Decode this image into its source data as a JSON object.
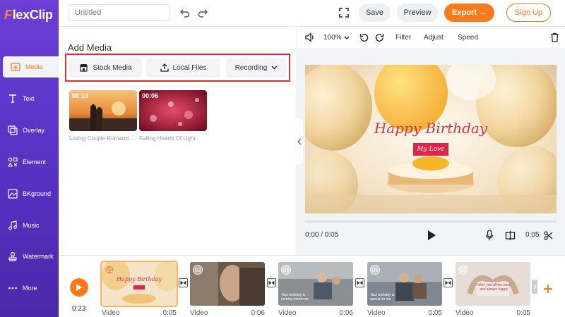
{
  "app": {
    "logo_prefix": "F",
    "logo_rest": "lexClip"
  },
  "sidebar": {
    "items": [
      {
        "label": "Media",
        "icon": "media-icon"
      },
      {
        "label": "Text",
        "icon": "text-icon"
      },
      {
        "label": "Overlay",
        "icon": "overlay-icon"
      },
      {
        "label": "Element",
        "icon": "element-icon"
      },
      {
        "label": "BKground",
        "icon": "background-icon"
      },
      {
        "label": "Music",
        "icon": "music-icon"
      },
      {
        "label": "Watermark",
        "icon": "watermark-icon"
      },
      {
        "label": "More",
        "icon": "more-icon"
      }
    ]
  },
  "topbar": {
    "title_placeholder": "Untitled",
    "save_label": "Save",
    "preview_label": "Preview",
    "export_label": "Export →",
    "signup_label": "Sign Up"
  },
  "media_panel": {
    "title": "Add Media",
    "stock_label": "Stock Media",
    "local_label": "Local Files",
    "recording_label": "Recording",
    "thumbs": [
      {
        "duration": "00:13",
        "caption": "Loving Couple Romanci..."
      },
      {
        "duration": "00:06",
        "caption": "Falling Hearts Of Light"
      }
    ]
  },
  "preview": {
    "zoom": "100%",
    "filter_label": "Filter",
    "adjust_label": "Adjust",
    "speed_label": "Speed",
    "canvas_title": "Happy Birthday",
    "canvas_tag": "My Love",
    "time_current": "0:00 / 0:05",
    "clip_duration": "0:05"
  },
  "timeline": {
    "total_time": "0:23",
    "clips": [
      {
        "num": "01",
        "type": "Video",
        "duration": "0:05",
        "selected": true,
        "text": "Happy Birthday"
      },
      {
        "num": "02",
        "type": "Video",
        "duration": "0:06",
        "selected": false,
        "text": ""
      },
      {
        "num": "03",
        "type": "Video",
        "duration": "0:06",
        "selected": false,
        "text": "Your birthday is coming tomorrow"
      },
      {
        "num": "04",
        "type": "Video",
        "duration": "0:05",
        "selected": false,
        "text": "Your birthday is special to me"
      },
      {
        "num": "05",
        "type": "Video",
        "duration": "0:05",
        "selected": false,
        "text": "Wish you all the best and always happy"
      }
    ]
  },
  "colors": {
    "accent": "#ff7a1a",
    "sidebar": "#5a34c8",
    "highlight": "#d9343e"
  }
}
